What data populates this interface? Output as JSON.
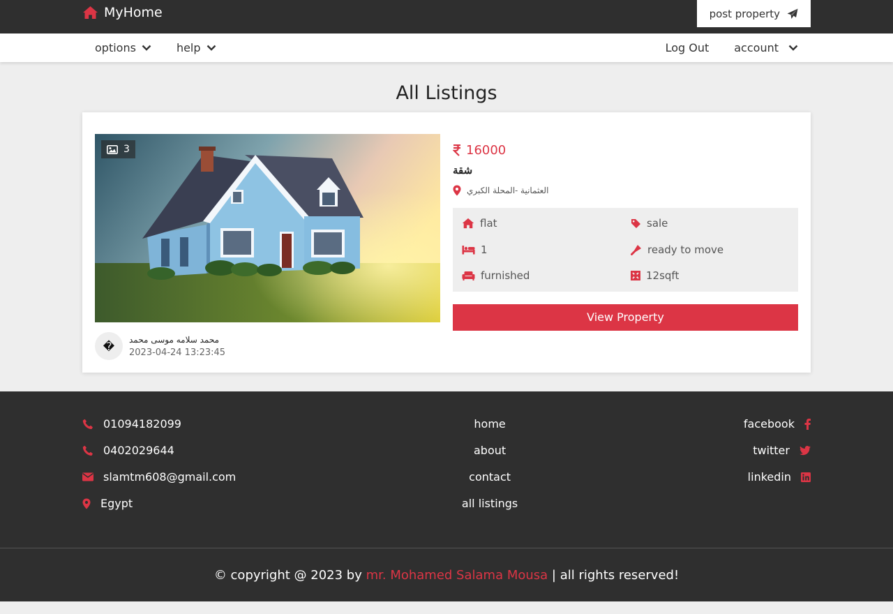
{
  "header": {
    "brand": "MyHome",
    "post_property": "post property"
  },
  "nav": {
    "options": "options",
    "help": "help",
    "logout": "Log Out",
    "account": "account"
  },
  "page_title": "All Listings",
  "listing": {
    "image_count": "3",
    "price": "16000",
    "currency_icon": "rupee-icon",
    "title": "شقة",
    "address": "العثمانية -المحلة الكبري",
    "features": {
      "type": "flat",
      "offer": "sale",
      "bedrooms": "1",
      "status": "ready to move",
      "furnishing": "furnished",
      "area": "12sqft"
    },
    "view_button": "View Property",
    "owner_avatar": "�",
    "owner_name": "محمد سلامه موسى محمد",
    "posted_date": "2023-04-24 13:23:45"
  },
  "footer": {
    "phone1": "01094182099",
    "phone2": "0402029644",
    "email": "slamtm608@gmail.com",
    "location": "Egypt",
    "links": {
      "home": "home",
      "about": "about",
      "contact": "contact",
      "all_listings": "all listings"
    },
    "social": {
      "facebook": "facebook",
      "twitter": "twitter",
      "linkedin": "linkedin"
    },
    "copyright_prefix": "© copyright @ 2023 by ",
    "author": "mr. Mohamed Salama Mousa",
    "copyright_suffix": " | all rights reserved!"
  },
  "colors": {
    "accent": "#dc3545",
    "dark": "#2f2f2f",
    "background": "#eeeeee"
  }
}
